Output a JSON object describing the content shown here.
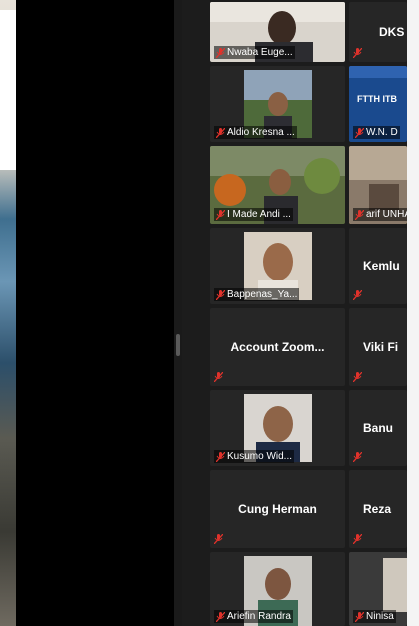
{
  "participants": [
    {
      "name": "Nwaba Euge..."
    },
    {
      "name": "DKS"
    },
    {
      "name": "Aldio Kresna ..."
    },
    {
      "name": "W.N. D",
      "slide_title": "FTTH ITB"
    },
    {
      "name": "I Made Andi ..."
    },
    {
      "name": "arif UNHA"
    },
    {
      "name": "Bappenas_Ya..."
    },
    {
      "name": "Kemlu"
    },
    {
      "name": "Account Zoom..."
    },
    {
      "name": "Viki Fi"
    },
    {
      "name": "Kusumo Wid..."
    },
    {
      "name": "Banu"
    },
    {
      "name": "Cung Herman"
    },
    {
      "name": "Reza"
    },
    {
      "name": "Ariefin Randra"
    },
    {
      "name": "Ninisa"
    }
  ],
  "colors": {
    "muted_mic": "#e0322b",
    "tile_bg": "#262626",
    "active_speaker": "#e6c24a"
  },
  "icons": {
    "mic": "muted-mic-icon"
  }
}
